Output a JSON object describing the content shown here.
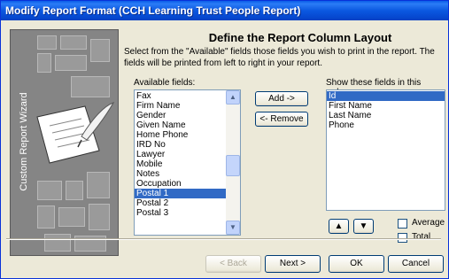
{
  "window": {
    "title": "Modify Report Format (CCH Learning Trust People Report)"
  },
  "wizard": {
    "side_label": "Custom Report Wizard"
  },
  "header": {
    "title": "Define the Report Column Layout",
    "description": "Select from the \"Available\" fields those fields you wish to print in the report. The fields will be printed from left to right in your report."
  },
  "available": {
    "label": "Available fields:",
    "items": [
      "Fax",
      "Firm Name",
      "Gender",
      "Given Name",
      "Home Phone",
      "IRD No",
      "Lawyer",
      "Mobile",
      "Notes",
      "Occupation",
      "Postal 1",
      "Postal 2",
      "Postal 3"
    ],
    "selected": "Postal 1"
  },
  "selected_fields": {
    "label": "Show these fields in this order:",
    "items": [
      "Id",
      "First Name",
      "Last Name",
      "Phone"
    ],
    "selected": "Id"
  },
  "buttons": {
    "add": "Add ->",
    "remove": "<- Remove",
    "back": "< Back",
    "next": "Next >",
    "ok": "OK",
    "cancel": "Cancel"
  },
  "options": {
    "average": "Average",
    "total": "Total"
  },
  "icons": {
    "move_up": "move-up-icon",
    "move_down": "move-down-icon"
  }
}
